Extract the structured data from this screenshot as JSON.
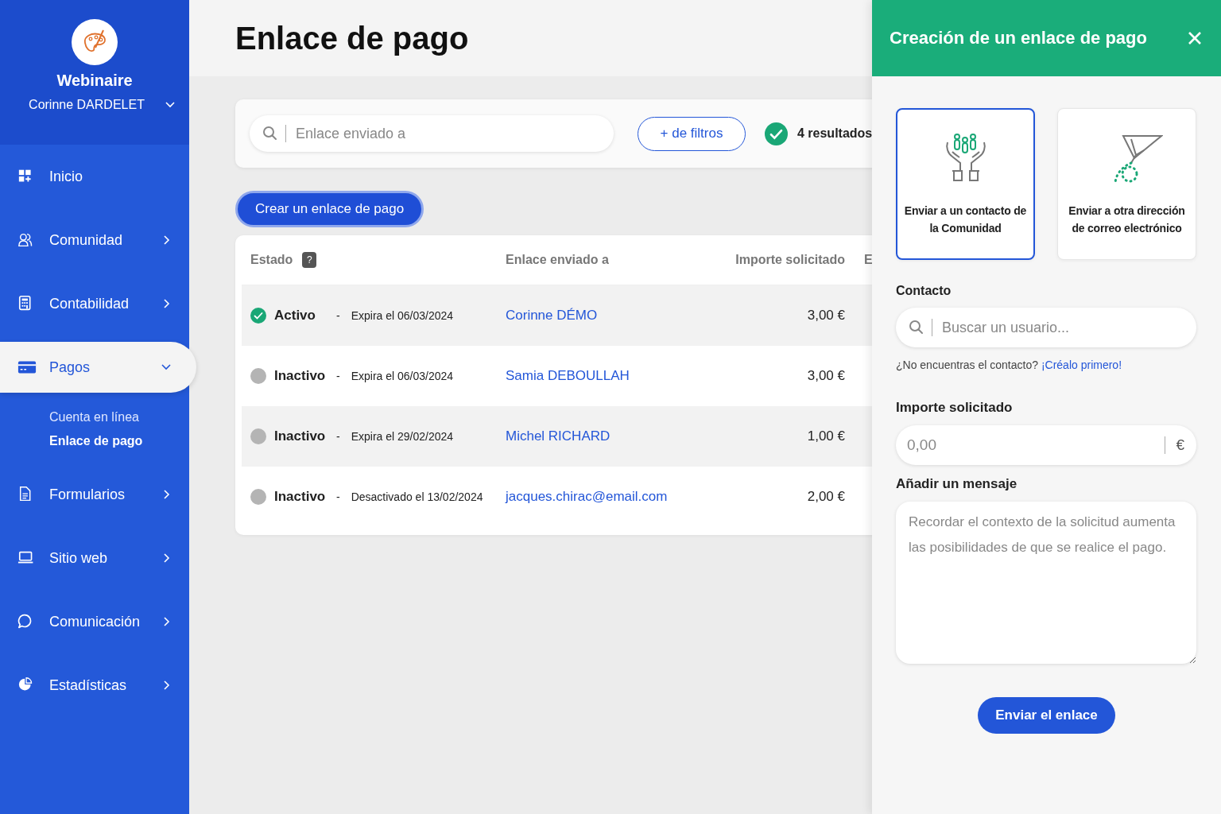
{
  "sidebar": {
    "org": "Webinaire",
    "user": "Corinne DARDELET",
    "items": [
      {
        "label": "Inicio",
        "expandable": false,
        "expanded": false,
        "selected": false
      },
      {
        "label": "Comunidad",
        "expandable": true,
        "expanded": false,
        "selected": false
      },
      {
        "label": "Contabilidad",
        "expandable": true,
        "expanded": false,
        "selected": false
      },
      {
        "label": "Pagos",
        "expandable": true,
        "expanded": true,
        "selected": true,
        "children": [
          {
            "label": "Cuenta en línea",
            "selected": false
          },
          {
            "label": "Enlace de pago",
            "selected": true
          }
        ]
      },
      {
        "label": "Formularios",
        "expandable": true,
        "expanded": false,
        "selected": false
      },
      {
        "label": "Sitio web",
        "expandable": true,
        "expanded": false,
        "selected": false
      },
      {
        "label": "Comunicación",
        "expandable": true,
        "expanded": false,
        "selected": false
      },
      {
        "label": "Estadísticas",
        "expandable": true,
        "expanded": false,
        "selected": false
      }
    ]
  },
  "page_title": "Enlace de pago",
  "search": {
    "placeholder": "Enlace enviado a"
  },
  "filter_button": "+ de filtros",
  "results": "4 resultados",
  "create_button": "Crear un enlace de pago",
  "table": {
    "columns": [
      "Estado",
      "Enlace enviado a",
      "Importe solicitado",
      "E"
    ],
    "help_mark": "?",
    "rows": [
      {
        "status": "Activo",
        "active": true,
        "separator": "-",
        "detail": "Expira el 06/03/2024",
        "recipient": "Corinne DÉMO",
        "amount": "3,00 €"
      },
      {
        "status": "Inactivo",
        "active": false,
        "separator": "-",
        "detail": "Expira el 06/03/2024",
        "recipient": "Samia DEBOULLAH",
        "amount": "3,00 €"
      },
      {
        "status": "Inactivo",
        "active": false,
        "separator": "-",
        "detail": "Expira el 29/02/2024",
        "recipient": "Michel RICHARD",
        "amount": "1,00 €"
      },
      {
        "status": "Inactivo",
        "active": false,
        "separator": "-",
        "detail": "Desactivado el 13/02/2024",
        "recipient": "jacques.chirac@email.com",
        "amount": "2,00 €"
      }
    ]
  },
  "panel": {
    "title": "Creación de un enlace de pago",
    "options": [
      {
        "label": "Enviar a un contacto de la Comunidad",
        "selected": true
      },
      {
        "label": "Enviar a otra dirección de correo electrónico",
        "selected": false
      }
    ],
    "contact_label": "Contacto",
    "contact_search": {
      "placeholder": "Buscar un usuario..."
    },
    "hint": "¿No encuentras el contacto?",
    "hint_link": "¡Créalo primero!",
    "amount_label": "Importe solicitado",
    "amount_field": {
      "placeholder": "0,00",
      "currency": "€"
    },
    "message_label": "Añadir un mensaje",
    "message_field": {
      "placeholder": "Recordar el contexto de la solicitud aumenta las posibilidades de que se realice el pago."
    },
    "submit": "Enviar el enlace"
  }
}
